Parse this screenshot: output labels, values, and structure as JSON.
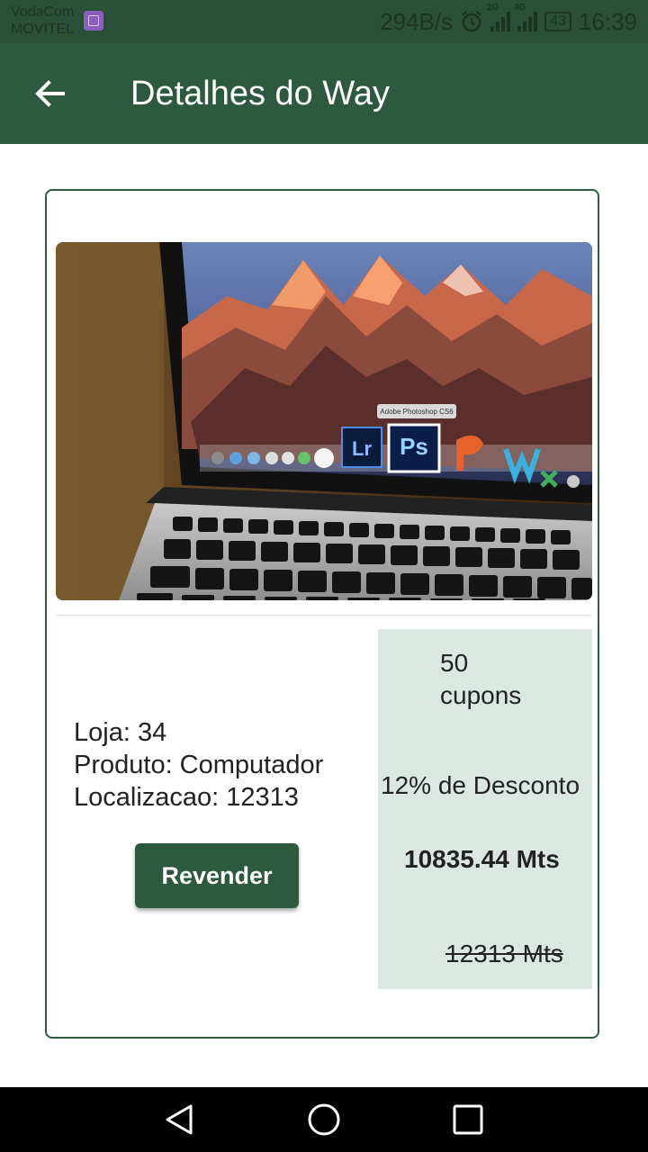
{
  "status_bar": {
    "carrier_line1": "VodaCom",
    "carrier_line2": "MOVITEL",
    "net_speed": "294B/s",
    "sim1_label": "2G",
    "sim2_label": "4G",
    "battery": "43",
    "time": "16:39"
  },
  "app_bar": {
    "title": "Detalhes do Way",
    "back_icon": "arrow-left-icon"
  },
  "product": {
    "image_alt": "Laptop with Adobe Photoshop CS6 icon on dock",
    "dock_tooltip": "Adobe Photoshop CS6",
    "store_line": "Loja: 34",
    "product_line": "Produto: Computador",
    "location_line": "Localizacao: 12313",
    "resell_label": "Revender"
  },
  "pricing": {
    "coupons_count": "50",
    "coupons_label": "cupons",
    "discount": "12% de Desconto",
    "final_price": "10835.44 Mts",
    "original_price": "12313 Mts"
  },
  "colors": {
    "primary": "#2d5a3f",
    "panel_bg": "#dde7e2"
  },
  "nav_bar": {
    "back": "nav-back-icon",
    "home": "nav-home-icon",
    "recents": "nav-recents-icon"
  }
}
